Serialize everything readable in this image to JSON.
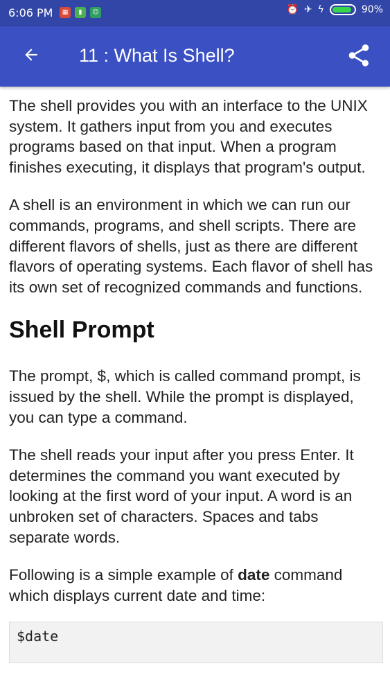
{
  "status_bar": {
    "time": "6:06 PM",
    "battery_percent": "90%",
    "battery_level": 0.9,
    "left_icons": [
      "calendar-app-icon",
      "sim-app-icon",
      "android-app-icon"
    ],
    "right_icons": [
      "alarm-icon",
      "airplane-mode-icon",
      "charging-icon",
      "battery-icon"
    ]
  },
  "toolbar": {
    "title": "11 : What Is Shell?",
    "back_icon": "arrow-left-icon",
    "share_icon": "share-icon",
    "color": "#3a50c3"
  },
  "content": {
    "p1": "The shell provides you with an interface to the UNIX system. It gathers input from you and executes programs based on that input. When a program finishes executing, it displays that program's output.",
    "p2": "A shell is an environment in which we can run our commands, programs, and shell scripts. There are different flavors of shells, just as there are different flavors of operating systems. Each flavor of shell has its own set of recognized commands and functions.",
    "heading": "Shell Prompt",
    "p3": "The prompt, $, which is called command prompt, is issued by the shell. While the prompt is displayed, you can type a command.",
    "p4": "The shell reads your input after you press Enter. It determines the command you want executed by looking at the first word of your input. A word is an unbroken set of characters. Spaces and tabs separate words.",
    "p5_before": "Following is a simple example of ",
    "p5_bold": "date",
    "p5_after": " command which displays current date and time:",
    "code": "$date"
  }
}
